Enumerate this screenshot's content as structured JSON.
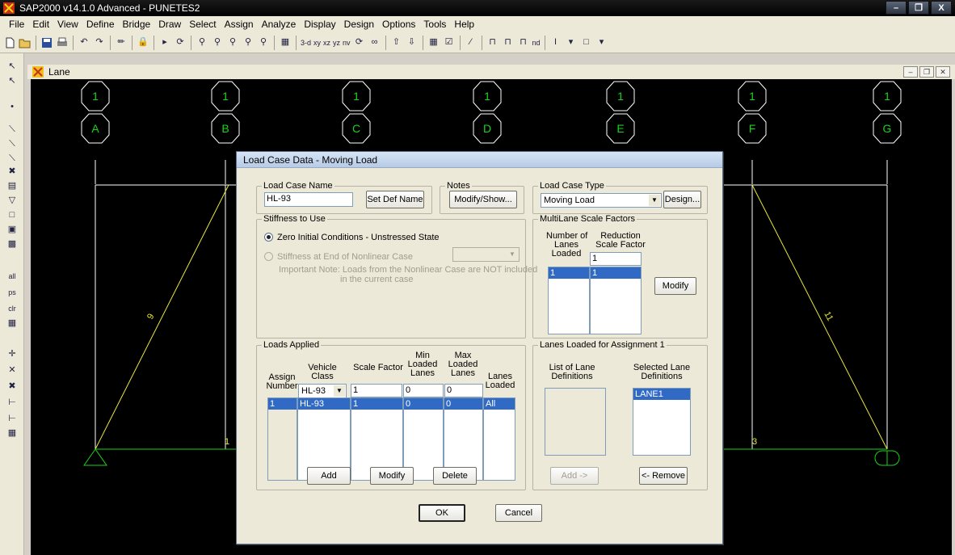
{
  "app": {
    "title": "SAP2000 v14.1.0 Advanced  -  PUNETES2"
  },
  "menu": [
    "File",
    "Edit",
    "View",
    "Define",
    "Bridge",
    "Draw",
    "Select",
    "Assign",
    "Analyze",
    "Display",
    "Design",
    "Options",
    "Tools",
    "Help"
  ],
  "toolbar": {
    "view_3d": "3-d",
    "view_xy": "xy",
    "view_xz": "xz",
    "view_yz": "yz",
    "view_nv": "nv",
    "nd_label": "nd"
  },
  "left_toolbar": {
    "all": "all",
    "ps": "ps",
    "clr": "clr"
  },
  "child_window": {
    "title": "Lane"
  },
  "canvas": {
    "grid_top_labels": [
      "1",
      "1",
      "1",
      "1",
      "1",
      "1",
      "1"
    ],
    "grid_bottom_labels": [
      "A",
      "B",
      "C",
      "D",
      "E",
      "F",
      "G"
    ],
    "frame_labels": {
      "left_diag": "9",
      "right_diag": "11",
      "bottom_left": "1",
      "bottom_right": "3"
    }
  },
  "dialog": {
    "title": "Load Case Data - Moving Load",
    "load_case_name": {
      "legend": "Load Case Name",
      "value": "HL-93",
      "set_def_btn": "Set Def Name"
    },
    "notes": {
      "legend": "Notes",
      "btn": "Modify/Show..."
    },
    "load_case_type": {
      "legend": "Load Case Type",
      "value": "Moving Load",
      "design_btn": "Design..."
    },
    "stiffness": {
      "legend": "Stiffness to Use",
      "opt1": "Zero Initial Conditions - Unstressed State",
      "opt2": "Stiffness at End of Nonlinear Case",
      "note1": "Important Note:  Loads from the Nonlinear Case are NOT included",
      "note2": "in the current case"
    },
    "multilane": {
      "legend": "MultiLane Scale Factors",
      "col1": [
        "Number of",
        "Lanes",
        "Loaded"
      ],
      "col2": [
        "Reduction",
        "Scale Factor"
      ],
      "input": "1",
      "row_lanes": "1",
      "row_factor": "1",
      "modify_btn": "Modify"
    },
    "loads_applied": {
      "legend": "Loads Applied",
      "headers": {
        "assign": [
          "Assign",
          "Number"
        ],
        "vehicle": [
          "Vehicle",
          "Class"
        ],
        "scale": "Scale Factor",
        "min": [
          "Min",
          "Loaded",
          "Lanes"
        ],
        "max": [
          "Max",
          "Loaded",
          "Lanes"
        ],
        "lanes": [
          "Lanes",
          "Loaded"
        ]
      },
      "inputs": {
        "vehicle": "HL-93",
        "scale": "1",
        "min": "0",
        "max": "0"
      },
      "row": {
        "assign": "1",
        "vehicle": "HL-93",
        "scale": "1",
        "min": "0",
        "max": "0",
        "lanes": "All"
      },
      "add_btn": "Add",
      "modify_btn": "Modify",
      "delete_btn": "Delete"
    },
    "lanes_loaded": {
      "legend": "Lanes Loaded for Assignment 1",
      "list_header": [
        "List of Lane",
        "Definitions"
      ],
      "selected_header": [
        "Selected Lane",
        "Definitions"
      ],
      "selected_item": "LANE1",
      "add_btn": "Add ->",
      "remove_btn": "<- Remove"
    },
    "ok_btn": "OK",
    "cancel_btn": "Cancel"
  }
}
